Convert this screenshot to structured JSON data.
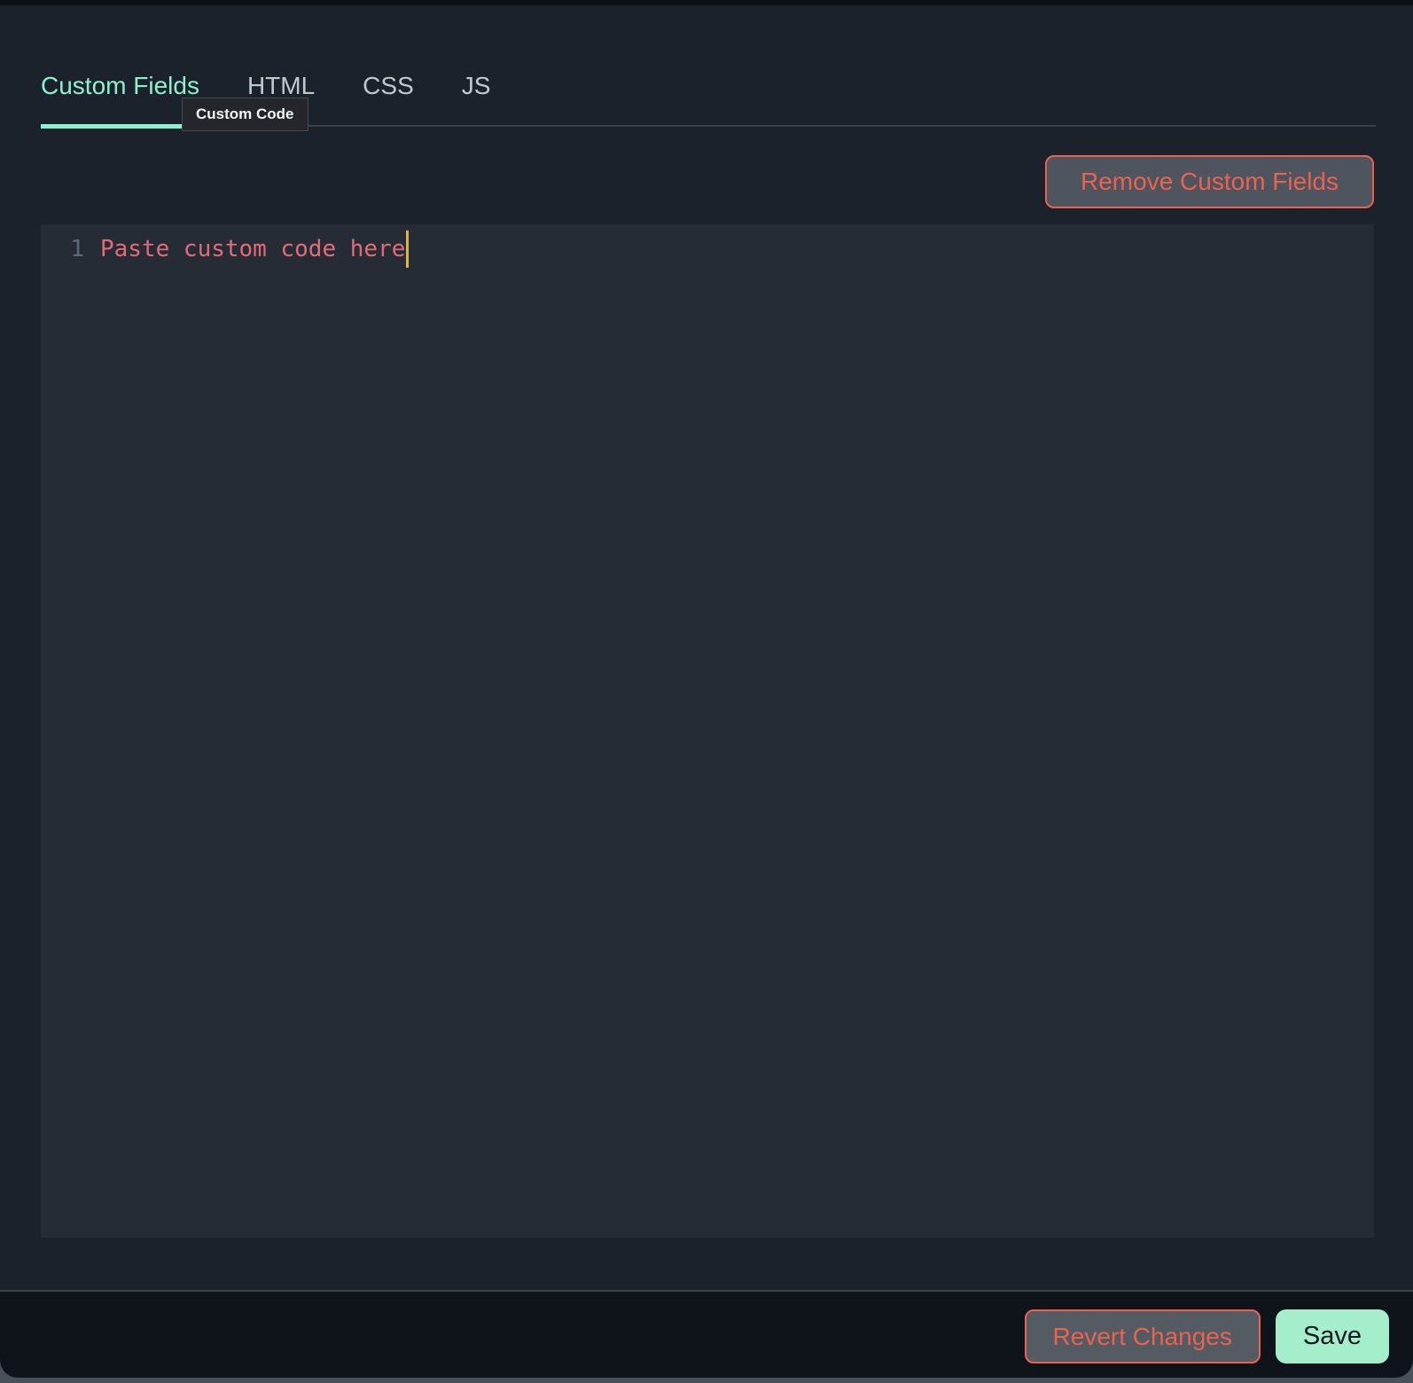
{
  "tabs": {
    "items": [
      {
        "label": "Custom Fields",
        "active": true
      },
      {
        "label": "HTML",
        "active": false
      },
      {
        "label": "CSS",
        "active": false
      },
      {
        "label": "JS",
        "active": false
      }
    ]
  },
  "tooltip": {
    "text": "Custom Code"
  },
  "toolbar": {
    "remove_button_label": "Remove Custom Fields"
  },
  "editor": {
    "lines": [
      {
        "number": "1",
        "code": "Paste custom code here"
      }
    ],
    "has_cursor_after_line_1": true
  },
  "footer": {
    "revert_button_label": "Revert Changes",
    "save_button_label": "Save"
  },
  "colors": {
    "accent_mint": "#8ef0cc",
    "accent_salmon": "#ea6350",
    "save_button_bg": "#a5eecc",
    "code_text": "#e06c75",
    "line_number": "#5d6975",
    "cursor": "#dcb73f",
    "main_bg": "#1b222c",
    "editor_bg": "#262c36",
    "footer_bg": "#0f141b"
  }
}
